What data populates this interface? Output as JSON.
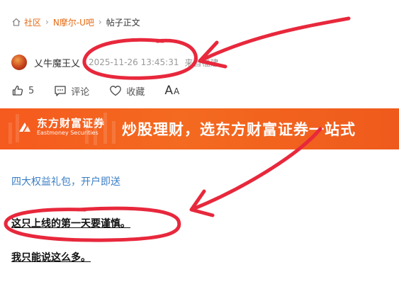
{
  "breadcrumb": {
    "home": "社区",
    "forum": "N摩尔-U吧",
    "current": "帖子正文"
  },
  "post": {
    "author": "乂牛魔王乂",
    "time": "2025-11-26 13:45:31",
    "location": "来自福建",
    "likes": "5",
    "comment_label": "评论",
    "favorite_label": "收藏",
    "font_big": "A",
    "font_small": "A"
  },
  "banner": {
    "brand_cn": "东方财富证券",
    "brand_en": "Eastmoney Securities",
    "slogan": "炒股理财，选东方财富证券一站式"
  },
  "promo": {
    "link_text": "四大权益礼包，开户即送"
  },
  "body": {
    "paragraphs": [
      "这只上线的第一天要谨慎。",
      "我只能说这么多。"
    ]
  },
  "colors": {
    "accent": "#e66a13",
    "banner": "#f46a20",
    "link": "#3a7ec6",
    "annotation": "#e8283c"
  },
  "icons": {
    "home": "home-icon",
    "like": "thumbs-up-icon",
    "comment": "comment-icon",
    "favorite": "heart-icon"
  }
}
